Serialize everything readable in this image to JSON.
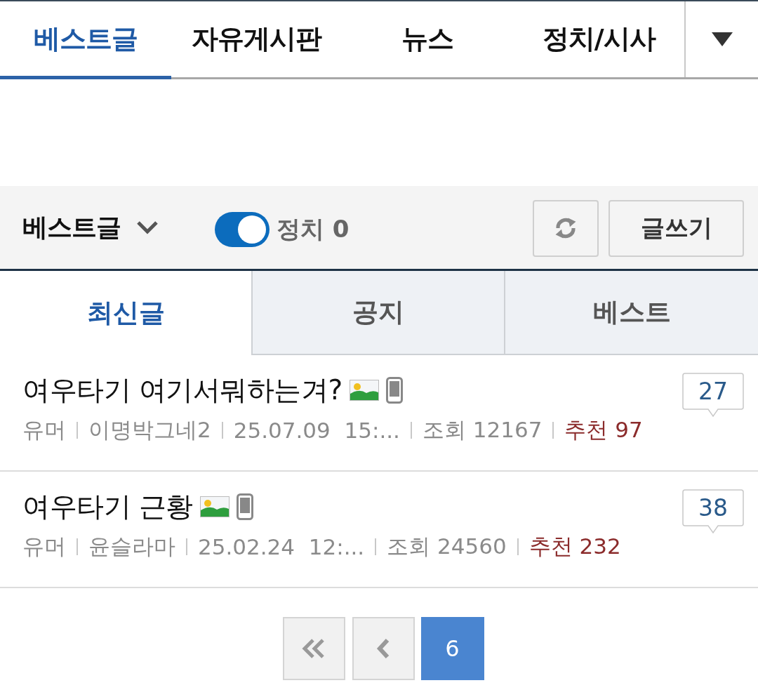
{
  "top_tabs": [
    {
      "label": "베스트글",
      "selected": true
    },
    {
      "label": "자유게시판",
      "selected": false
    },
    {
      "label": "뉴스",
      "selected": false
    },
    {
      "label": "정치/시사",
      "selected": false
    }
  ],
  "toolbar": {
    "board_select": "베스트글",
    "toggle": {
      "on": true,
      "label": "정치 0"
    },
    "write_button": "글쓰기"
  },
  "sub_tabs": [
    {
      "label": "최신글",
      "selected": true
    },
    {
      "label": "공지",
      "selected": false
    },
    {
      "label": "베스트",
      "selected": false
    }
  ],
  "posts": [
    {
      "title": "여우타기 여기서뭐하는겨?",
      "has_image": true,
      "mobile": true,
      "category": "유머",
      "author": "이명박그네2",
      "date": "25.07.09  15:...",
      "views": "조회 12167",
      "recommend": "추천 97",
      "comments": "27"
    },
    {
      "title": "여우타기 근황",
      "has_image": true,
      "mobile": true,
      "category": "유머",
      "author": "윤슬라마",
      "date": "25.02.24  12:...",
      "views": "조회 24560",
      "recommend": "추천 232",
      "comments": "38"
    }
  ],
  "pagination": {
    "pages": [
      {
        "label": "6",
        "selected": true
      }
    ]
  }
}
